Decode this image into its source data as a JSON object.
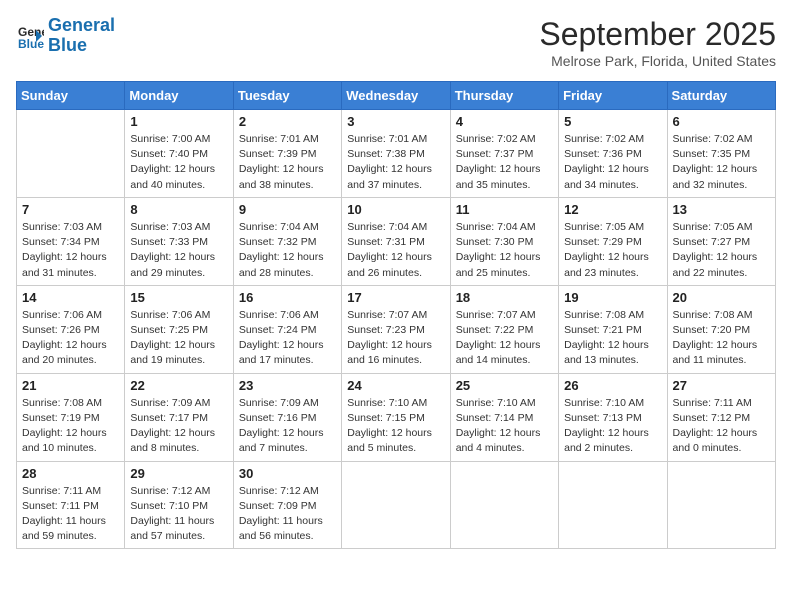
{
  "header": {
    "logo_line1": "General",
    "logo_line2": "Blue",
    "month_title": "September 2025",
    "location": "Melrose Park, Florida, United States"
  },
  "weekdays": [
    "Sunday",
    "Monday",
    "Tuesday",
    "Wednesday",
    "Thursday",
    "Friday",
    "Saturday"
  ],
  "weeks": [
    [
      {
        "day": "",
        "detail": ""
      },
      {
        "day": "1",
        "detail": "Sunrise: 7:00 AM\nSunset: 7:40 PM\nDaylight: 12 hours\nand 40 minutes."
      },
      {
        "day": "2",
        "detail": "Sunrise: 7:01 AM\nSunset: 7:39 PM\nDaylight: 12 hours\nand 38 minutes."
      },
      {
        "day": "3",
        "detail": "Sunrise: 7:01 AM\nSunset: 7:38 PM\nDaylight: 12 hours\nand 37 minutes."
      },
      {
        "day": "4",
        "detail": "Sunrise: 7:02 AM\nSunset: 7:37 PM\nDaylight: 12 hours\nand 35 minutes."
      },
      {
        "day": "5",
        "detail": "Sunrise: 7:02 AM\nSunset: 7:36 PM\nDaylight: 12 hours\nand 34 minutes."
      },
      {
        "day": "6",
        "detail": "Sunrise: 7:02 AM\nSunset: 7:35 PM\nDaylight: 12 hours\nand 32 minutes."
      }
    ],
    [
      {
        "day": "7",
        "detail": "Sunrise: 7:03 AM\nSunset: 7:34 PM\nDaylight: 12 hours\nand 31 minutes."
      },
      {
        "day": "8",
        "detail": "Sunrise: 7:03 AM\nSunset: 7:33 PM\nDaylight: 12 hours\nand 29 minutes."
      },
      {
        "day": "9",
        "detail": "Sunrise: 7:04 AM\nSunset: 7:32 PM\nDaylight: 12 hours\nand 28 minutes."
      },
      {
        "day": "10",
        "detail": "Sunrise: 7:04 AM\nSunset: 7:31 PM\nDaylight: 12 hours\nand 26 minutes."
      },
      {
        "day": "11",
        "detail": "Sunrise: 7:04 AM\nSunset: 7:30 PM\nDaylight: 12 hours\nand 25 minutes."
      },
      {
        "day": "12",
        "detail": "Sunrise: 7:05 AM\nSunset: 7:29 PM\nDaylight: 12 hours\nand 23 minutes."
      },
      {
        "day": "13",
        "detail": "Sunrise: 7:05 AM\nSunset: 7:27 PM\nDaylight: 12 hours\nand 22 minutes."
      }
    ],
    [
      {
        "day": "14",
        "detail": "Sunrise: 7:06 AM\nSunset: 7:26 PM\nDaylight: 12 hours\nand 20 minutes."
      },
      {
        "day": "15",
        "detail": "Sunrise: 7:06 AM\nSunset: 7:25 PM\nDaylight: 12 hours\nand 19 minutes."
      },
      {
        "day": "16",
        "detail": "Sunrise: 7:06 AM\nSunset: 7:24 PM\nDaylight: 12 hours\nand 17 minutes."
      },
      {
        "day": "17",
        "detail": "Sunrise: 7:07 AM\nSunset: 7:23 PM\nDaylight: 12 hours\nand 16 minutes."
      },
      {
        "day": "18",
        "detail": "Sunrise: 7:07 AM\nSunset: 7:22 PM\nDaylight: 12 hours\nand 14 minutes."
      },
      {
        "day": "19",
        "detail": "Sunrise: 7:08 AM\nSunset: 7:21 PM\nDaylight: 12 hours\nand 13 minutes."
      },
      {
        "day": "20",
        "detail": "Sunrise: 7:08 AM\nSunset: 7:20 PM\nDaylight: 12 hours\nand 11 minutes."
      }
    ],
    [
      {
        "day": "21",
        "detail": "Sunrise: 7:08 AM\nSunset: 7:19 PM\nDaylight: 12 hours\nand 10 minutes."
      },
      {
        "day": "22",
        "detail": "Sunrise: 7:09 AM\nSunset: 7:17 PM\nDaylight: 12 hours\nand 8 minutes."
      },
      {
        "day": "23",
        "detail": "Sunrise: 7:09 AM\nSunset: 7:16 PM\nDaylight: 12 hours\nand 7 minutes."
      },
      {
        "day": "24",
        "detail": "Sunrise: 7:10 AM\nSunset: 7:15 PM\nDaylight: 12 hours\nand 5 minutes."
      },
      {
        "day": "25",
        "detail": "Sunrise: 7:10 AM\nSunset: 7:14 PM\nDaylight: 12 hours\nand 4 minutes."
      },
      {
        "day": "26",
        "detail": "Sunrise: 7:10 AM\nSunset: 7:13 PM\nDaylight: 12 hours\nand 2 minutes."
      },
      {
        "day": "27",
        "detail": "Sunrise: 7:11 AM\nSunset: 7:12 PM\nDaylight: 12 hours\nand 0 minutes."
      }
    ],
    [
      {
        "day": "28",
        "detail": "Sunrise: 7:11 AM\nSunset: 7:11 PM\nDaylight: 11 hours\nand 59 minutes."
      },
      {
        "day": "29",
        "detail": "Sunrise: 7:12 AM\nSunset: 7:10 PM\nDaylight: 11 hours\nand 57 minutes."
      },
      {
        "day": "30",
        "detail": "Sunrise: 7:12 AM\nSunset: 7:09 PM\nDaylight: 11 hours\nand 56 minutes."
      },
      {
        "day": "",
        "detail": ""
      },
      {
        "day": "",
        "detail": ""
      },
      {
        "day": "",
        "detail": ""
      },
      {
        "day": "",
        "detail": ""
      }
    ]
  ]
}
